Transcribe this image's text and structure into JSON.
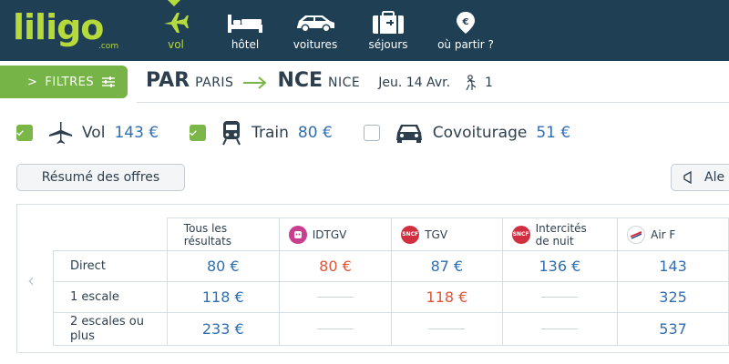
{
  "brand": {
    "logo": "liligo",
    "logo_suffix": ".com"
  },
  "nav": {
    "items": [
      {
        "label": "vol",
        "icon": "plane-icon",
        "active": true
      },
      {
        "label": "hôtel",
        "icon": "bed-icon",
        "active": false
      },
      {
        "label": "voitures",
        "icon": "car-icon",
        "active": false
      },
      {
        "label": "séjours",
        "icon": "suitcase-icon",
        "active": false
      },
      {
        "label": "où partir ?",
        "icon": "location-pin-icon",
        "active": false
      }
    ]
  },
  "filters": {
    "label": "FILTRES",
    "prefix": ">",
    "icon": "sliders-icon"
  },
  "route": {
    "from_code": "PAR",
    "from_city": "PARIS",
    "to_code": "NCE",
    "to_city": "NICE",
    "date": "Jeu. 14 Avr.",
    "passengers": "1"
  },
  "modes": [
    {
      "name": "Vol",
      "price": "143 €",
      "checked": true,
      "icon": "plane-icon"
    },
    {
      "name": "Train",
      "price": "80 €",
      "checked": true,
      "icon": "train-icon"
    },
    {
      "name": "Covoiturage",
      "price": "51 €",
      "checked": false,
      "icon": "car-icon"
    }
  ],
  "tabs": {
    "summary": "Résumé des offres",
    "alert": "Ale"
  },
  "table": {
    "columns": [
      {
        "label_line1": "Tous les",
        "label_line2": "résultats",
        "logo": ""
      },
      {
        "label_line1": "IDTGV",
        "label_line2": "",
        "logo": "idtgv-logo"
      },
      {
        "label_line1": "TGV",
        "label_line2": "",
        "logo": "sncf-logo",
        "logo_text": "SNCF"
      },
      {
        "label_line1": "Intercités",
        "label_line2": "de nuit",
        "logo": "sncf-logo",
        "logo_text": "SNCF"
      },
      {
        "label_line1": "Air F",
        "label_line2": "",
        "logo": "air-france-logo"
      }
    ],
    "rows": [
      {
        "label_line1": "Direct",
        "label_line2": "",
        "cells": [
          {
            "value": "80 €",
            "best": false
          },
          {
            "value": "80 €",
            "best": true
          },
          {
            "value": "87 €",
            "best": false
          },
          {
            "value": "136 €",
            "best": false
          },
          {
            "value": "143",
            "best": false
          }
        ]
      },
      {
        "label_line1": "1 escale",
        "label_line2": "",
        "cells": [
          {
            "value": "118 €",
            "best": false
          },
          {
            "value": "",
            "best": false
          },
          {
            "value": "118 €",
            "best": true
          },
          {
            "value": "",
            "best": false
          },
          {
            "value": "325",
            "best": false
          }
        ]
      },
      {
        "label_line1": "2 escales ou",
        "label_line2": "plus",
        "cells": [
          {
            "value": "233 €",
            "best": false
          },
          {
            "value": "",
            "best": false
          },
          {
            "value": "",
            "best": false
          },
          {
            "value": "",
            "best": false
          },
          {
            "value": "537",
            "best": false
          }
        ]
      }
    ]
  },
  "colors": {
    "header_bg": "#1e3f54",
    "brand_green": "#b6d93b",
    "filter_green": "#76b448",
    "price_blue": "#2f6fb0",
    "best_price_red": "#e0553a"
  }
}
